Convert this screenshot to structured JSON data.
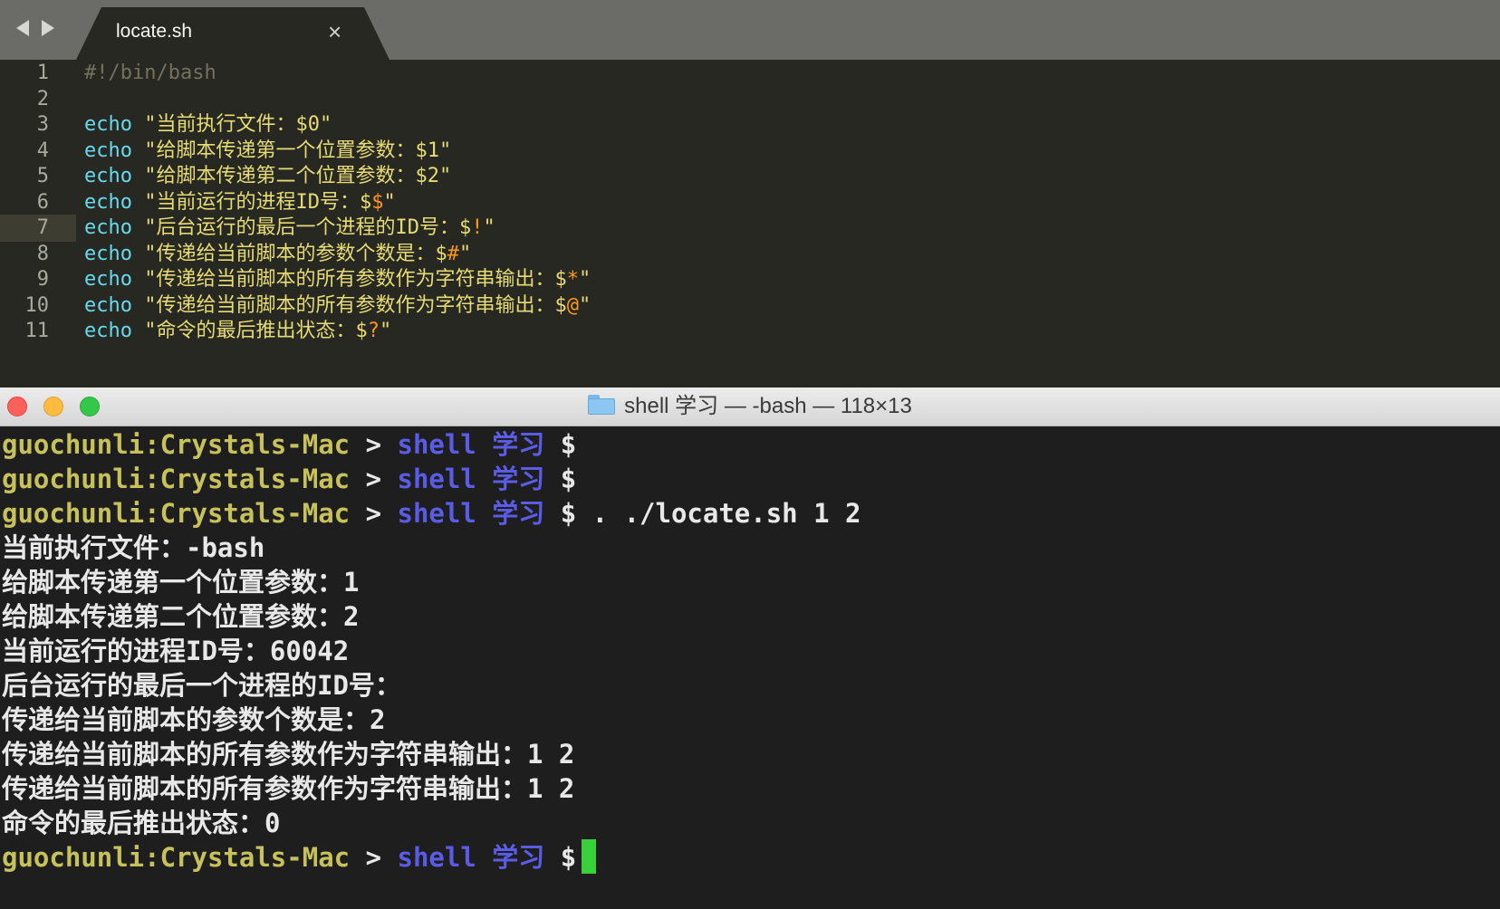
{
  "editor": {
    "tab_title": "locate.sh",
    "tab_close_glyph": "×",
    "active_line": 7,
    "lines": [
      {
        "num": "1",
        "tokens": [
          {
            "t": "#!/bin/bash",
            "k": "comment"
          }
        ]
      },
      {
        "num": "2",
        "tokens": []
      },
      {
        "num": "3",
        "tokens": [
          {
            "t": "echo",
            "k": "kw"
          },
          {
            "t": " ",
            "k": "plain"
          },
          {
            "t": "\"当前执行文件：$0\"",
            "k": "str"
          }
        ]
      },
      {
        "num": "4",
        "tokens": [
          {
            "t": "echo",
            "k": "kw"
          },
          {
            "t": " ",
            "k": "plain"
          },
          {
            "t": "\"给脚本传递第一个位置参数：$1\"",
            "k": "str"
          }
        ]
      },
      {
        "num": "5",
        "tokens": [
          {
            "t": "echo",
            "k": "kw"
          },
          {
            "t": " ",
            "k": "plain"
          },
          {
            "t": "\"给脚本传递第二个位置参数：$2\"",
            "k": "str"
          }
        ]
      },
      {
        "num": "6",
        "tokens": [
          {
            "t": "echo",
            "k": "kw"
          },
          {
            "t": " ",
            "k": "plain"
          },
          {
            "t": "\"当前运行的进程ID号：$",
            "k": "str"
          },
          {
            "t": "$",
            "k": "var"
          },
          {
            "t": "\"",
            "k": "str"
          }
        ]
      },
      {
        "num": "7",
        "tokens": [
          {
            "t": "echo",
            "k": "kw"
          },
          {
            "t": " ",
            "k": "plain"
          },
          {
            "t": "\"后台运行的最后一个进程的ID号：$",
            "k": "str"
          },
          {
            "t": "!",
            "k": "var"
          },
          {
            "t": "\"",
            "k": "str"
          }
        ]
      },
      {
        "num": "8",
        "tokens": [
          {
            "t": "echo",
            "k": "kw"
          },
          {
            "t": " ",
            "k": "plain"
          },
          {
            "t": "\"传递给当前脚本的参数个数是：$",
            "k": "str"
          },
          {
            "t": "#",
            "k": "var"
          },
          {
            "t": "\"",
            "k": "str"
          }
        ]
      },
      {
        "num": "9",
        "tokens": [
          {
            "t": "echo",
            "k": "kw"
          },
          {
            "t": " ",
            "k": "plain"
          },
          {
            "t": "\"传递给当前脚本的所有参数作为字符串输出：$",
            "k": "str"
          },
          {
            "t": "*",
            "k": "var"
          },
          {
            "t": "\"",
            "k": "str"
          }
        ]
      },
      {
        "num": "10",
        "tokens": [
          {
            "t": "echo",
            "k": "kw"
          },
          {
            "t": " ",
            "k": "plain"
          },
          {
            "t": "\"传递给当前脚本的所有参数作为字符串输出：$",
            "k": "str"
          },
          {
            "t": "@",
            "k": "var"
          },
          {
            "t": "\"",
            "k": "str"
          }
        ]
      },
      {
        "num": "11",
        "tokens": [
          {
            "t": "echo",
            "k": "kw"
          },
          {
            "t": " ",
            "k": "plain"
          },
          {
            "t": "\"命令的最后推出状态：$",
            "k": "str"
          },
          {
            "t": "?",
            "k": "var"
          },
          {
            "t": "\"",
            "k": "str"
          }
        ]
      }
    ]
  },
  "terminal": {
    "window_title": "shell 学习 — -bash — 118×13",
    "prompt": {
      "user": "guochunli:Crystals-Mac",
      "sep": " > ",
      "dir": "shell 学习",
      "dollar": " $"
    },
    "lines": [
      {
        "type": "prompt",
        "cmd": ""
      },
      {
        "type": "prompt",
        "cmd": ""
      },
      {
        "type": "prompt",
        "cmd": " . ./locate.sh 1 2"
      },
      {
        "type": "output",
        "text": "当前执行文件：-bash"
      },
      {
        "type": "output",
        "text": "给脚本传递第一个位置参数：1"
      },
      {
        "type": "output",
        "text": "给脚本传递第二个位置参数：2"
      },
      {
        "type": "output",
        "text": "当前运行的进程ID号：60042"
      },
      {
        "type": "output",
        "text": "后台运行的最后一个进程的ID号："
      },
      {
        "type": "output",
        "text": "传递给当前脚本的参数个数是：2"
      },
      {
        "type": "output",
        "text": "传递给当前脚本的所有参数作为字符串输出：1 2"
      },
      {
        "type": "output",
        "text": "传递给当前脚本的所有参数作为字符串输出：1 2"
      },
      {
        "type": "output",
        "text": "命令的最后推出状态：0"
      },
      {
        "type": "prompt",
        "cmd": "",
        "cursor": true
      }
    ]
  },
  "colors": {
    "editor_bg": "#272822",
    "keyword": "#66d9ef",
    "string": "#e6db74",
    "variable": "#fd971f",
    "comment": "#75715e",
    "prompt_user": "#c6c15b",
    "prompt_dir": "#5a5ce6",
    "cursor": "#39d139"
  },
  "icons": {
    "nav_back": "triangle-left",
    "nav_forward": "triangle-right",
    "tab_close": "close-icon",
    "title_folder": "folder-icon"
  }
}
